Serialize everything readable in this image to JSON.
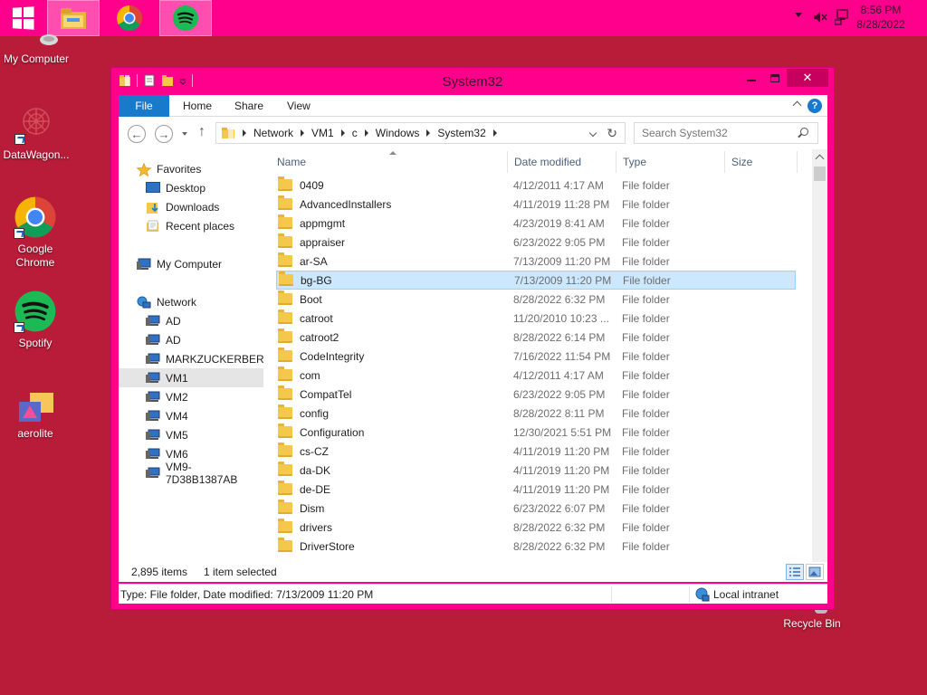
{
  "taskbar": {
    "apps": [
      "start",
      "file-explorer",
      "chrome",
      "spotify"
    ],
    "clock_time": "8:56 PM",
    "clock_date": "8/28/2022"
  },
  "desktop": {
    "icons": [
      {
        "label": "My Computer",
        "icon": "computer-icon"
      },
      {
        "label": "DataWagon...",
        "icon": "datawagon-icon"
      },
      {
        "label": "Google Chrome",
        "icon": "chrome-icon"
      },
      {
        "label": "Spotify",
        "icon": "spotify-icon"
      },
      {
        "label": "aerolite",
        "icon": "aerolite-icon"
      },
      {
        "label": "Recycle Bin",
        "icon": "recycle-bin-icon"
      }
    ]
  },
  "window": {
    "title": "System32",
    "ribbon_tabs": [
      "File",
      "Home",
      "Share",
      "View"
    ],
    "help_label": "?",
    "address": [
      "Network",
      "VM1",
      "c",
      "Windows",
      "System32"
    ],
    "search_placeholder": "Search System32"
  },
  "navpane": {
    "favorites_label": "Favorites",
    "favorites": [
      "Desktop",
      "Downloads",
      "Recent places"
    ],
    "my_computer_label": "My Computer",
    "network_label": "Network",
    "network_items": [
      "AD",
      "AD",
      "MARKZUCKERBERG",
      "VM1",
      "VM2",
      "VM4",
      "VM5",
      "VM6",
      "VM9-7D38B1387AB"
    ],
    "selected": "VM1"
  },
  "file_list": {
    "columns": [
      "Name",
      "Date modified",
      "Type",
      "Size"
    ],
    "rows": [
      {
        "name": "0409",
        "date": "4/12/2011 4:17 AM",
        "type": "File folder"
      },
      {
        "name": "AdvancedInstallers",
        "date": "4/11/2019 11:28 PM",
        "type": "File folder"
      },
      {
        "name": "appmgmt",
        "date": "4/23/2019 8:41 AM",
        "type": "File folder"
      },
      {
        "name": "appraiser",
        "date": "6/23/2022 9:05 PM",
        "type": "File folder"
      },
      {
        "name": "ar-SA",
        "date": "7/13/2009 11:20 PM",
        "type": "File folder"
      },
      {
        "name": "bg-BG",
        "date": "7/13/2009 11:20 PM",
        "type": "File folder"
      },
      {
        "name": "Boot",
        "date": "8/28/2022 6:32 PM",
        "type": "File folder"
      },
      {
        "name": "catroot",
        "date": "11/20/2010 10:23 ...",
        "type": "File folder"
      },
      {
        "name": "catroot2",
        "date": "8/28/2022 6:14 PM",
        "type": "File folder"
      },
      {
        "name": "CodeIntegrity",
        "date": "7/16/2022 11:54 PM",
        "type": "File folder"
      },
      {
        "name": "com",
        "date": "4/12/2011 4:17 AM",
        "type": "File folder"
      },
      {
        "name": "CompatTel",
        "date": "6/23/2022 9:05 PM",
        "type": "File folder"
      },
      {
        "name": "config",
        "date": "8/28/2022 8:11 PM",
        "type": "File folder"
      },
      {
        "name": "Configuration",
        "date": "12/30/2021 5:51 PM",
        "type": "File folder"
      },
      {
        "name": "cs-CZ",
        "date": "4/11/2019 11:20 PM",
        "type": "File folder"
      },
      {
        "name": "da-DK",
        "date": "4/11/2019 11:20 PM",
        "type": "File folder"
      },
      {
        "name": "de-DE",
        "date": "4/11/2019 11:20 PM",
        "type": "File folder"
      },
      {
        "name": "Dism",
        "date": "6/23/2022 6:07 PM",
        "type": "File folder"
      },
      {
        "name": "drivers",
        "date": "8/28/2022 6:32 PM",
        "type": "File folder"
      },
      {
        "name": "DriverStore",
        "date": "8/28/2022 6:32 PM",
        "type": "File folder"
      }
    ],
    "selected_index": 5
  },
  "status": {
    "item_count": "2,895 items",
    "selection": "1 item selected",
    "details": "Type: File folder, Date modified: 7/13/2009 11:20 PM",
    "zone": "Local intranet"
  },
  "colors": {
    "accent": "#ff008c",
    "desktop": "#b81c39",
    "file_tab": "#1979ca",
    "selection": "#cce8ff"
  }
}
